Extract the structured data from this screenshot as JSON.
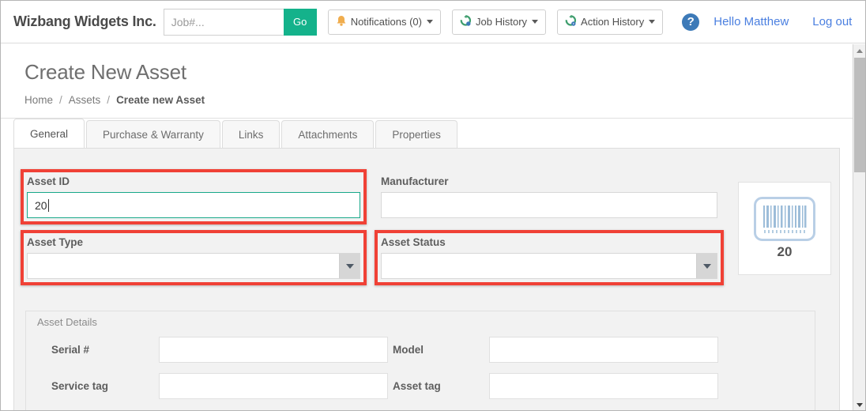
{
  "topnav": {
    "brand": "Wizbang Widgets Inc.",
    "search": {
      "placeholder": "Job#...",
      "value": ""
    },
    "go_label": "Go",
    "notifications_label": "Notifications (0)",
    "job_history_label": "Job History",
    "action_history_label": "Action History",
    "help_glyph": "?",
    "greeting": "Hello Matthew",
    "logout": "Log out"
  },
  "page": {
    "title": "Create New Asset",
    "breadcrumb": {
      "home": "Home",
      "assets": "Assets",
      "current": "Create new Asset",
      "separator": "/"
    }
  },
  "tabs": [
    {
      "label": "General",
      "active": true
    },
    {
      "label": "Purchase & Warranty",
      "active": false
    },
    {
      "label": "Links",
      "active": false
    },
    {
      "label": "Attachments",
      "active": false
    },
    {
      "label": "Properties",
      "active": false
    }
  ],
  "form": {
    "asset_id": {
      "label": "Asset ID",
      "value": "20",
      "highlighted": true,
      "focused": true
    },
    "manufacturer": {
      "label": "Manufacturer",
      "value": "",
      "highlighted": false
    },
    "asset_type": {
      "label": "Asset Type",
      "value": "",
      "highlighted": true
    },
    "asset_status": {
      "label": "Asset Status",
      "value": "",
      "highlighted": true
    }
  },
  "barcode": {
    "label": "20",
    "icon": "barcode-icon"
  },
  "details": {
    "legend": "Asset Details",
    "fields": [
      {
        "label": "Serial #",
        "value": ""
      },
      {
        "label": "Model",
        "value": ""
      },
      {
        "label": "Service tag",
        "value": ""
      },
      {
        "label": "Asset tag",
        "value": ""
      }
    ]
  },
  "colors": {
    "highlight_red": "#f04136",
    "go_green": "#14b28b",
    "focus_teal": "#18a88a",
    "link_blue": "#4a7fe0",
    "bell_orange": "#f0ad4e",
    "history_green": "#4caf7d",
    "help_blue": "#3d7ab8",
    "panel_grey": "#f2f2f2"
  }
}
